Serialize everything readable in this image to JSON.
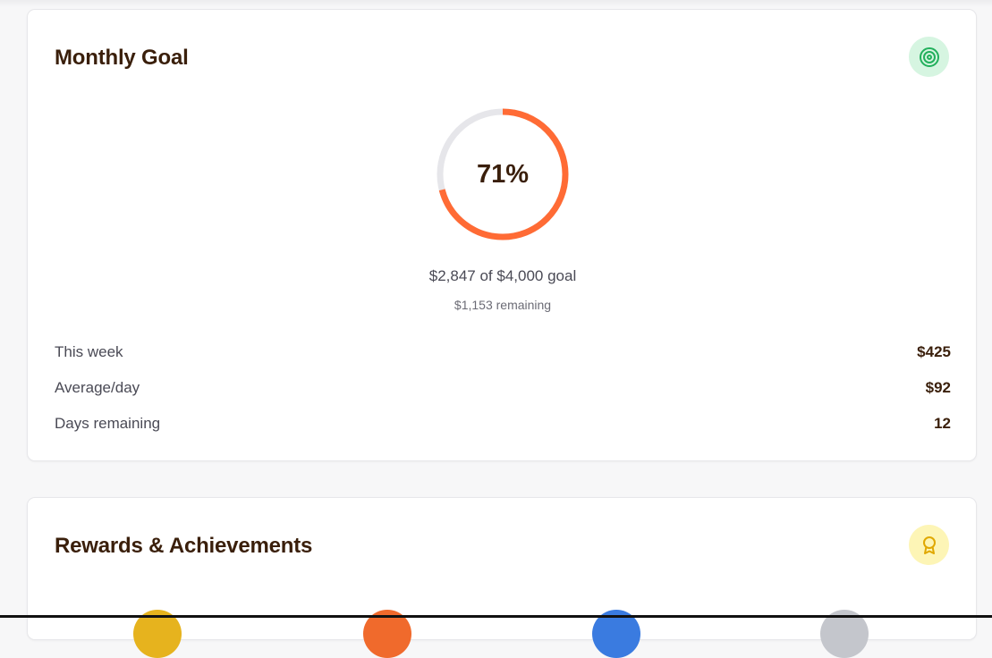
{
  "goal_card": {
    "title": "Monthly Goal",
    "icon": "target-icon",
    "progress_percent_label": "71%",
    "progress_fraction": 0.71,
    "summary": "$2,847 of $4,000 goal",
    "remaining": "$1,153 remaining",
    "stats": [
      {
        "label": "This week",
        "value": "$425"
      },
      {
        "label": "Average/day",
        "value": "$92"
      },
      {
        "label": "Days remaining",
        "value": "12"
      }
    ],
    "colors": {
      "progress": "#ff6b35",
      "track": "#e6e6ea",
      "icon": "#22b05c",
      "icon_bg": "#d6f5e1"
    }
  },
  "rewards_card": {
    "title": "Rewards & Achievements",
    "icon": "award-ribbon-icon",
    "badges": [
      {
        "name": "gold-badge",
        "color": "#e6b31e"
      },
      {
        "name": "orange-badge",
        "color": "#f06a2c"
      },
      {
        "name": "blue-badge",
        "color": "#3a7be0"
      },
      {
        "name": "gray-badge",
        "color": "#c4c6cc"
      }
    ],
    "colors": {
      "icon": "#e0a800",
      "icon_bg": "#fdf5b6"
    }
  }
}
